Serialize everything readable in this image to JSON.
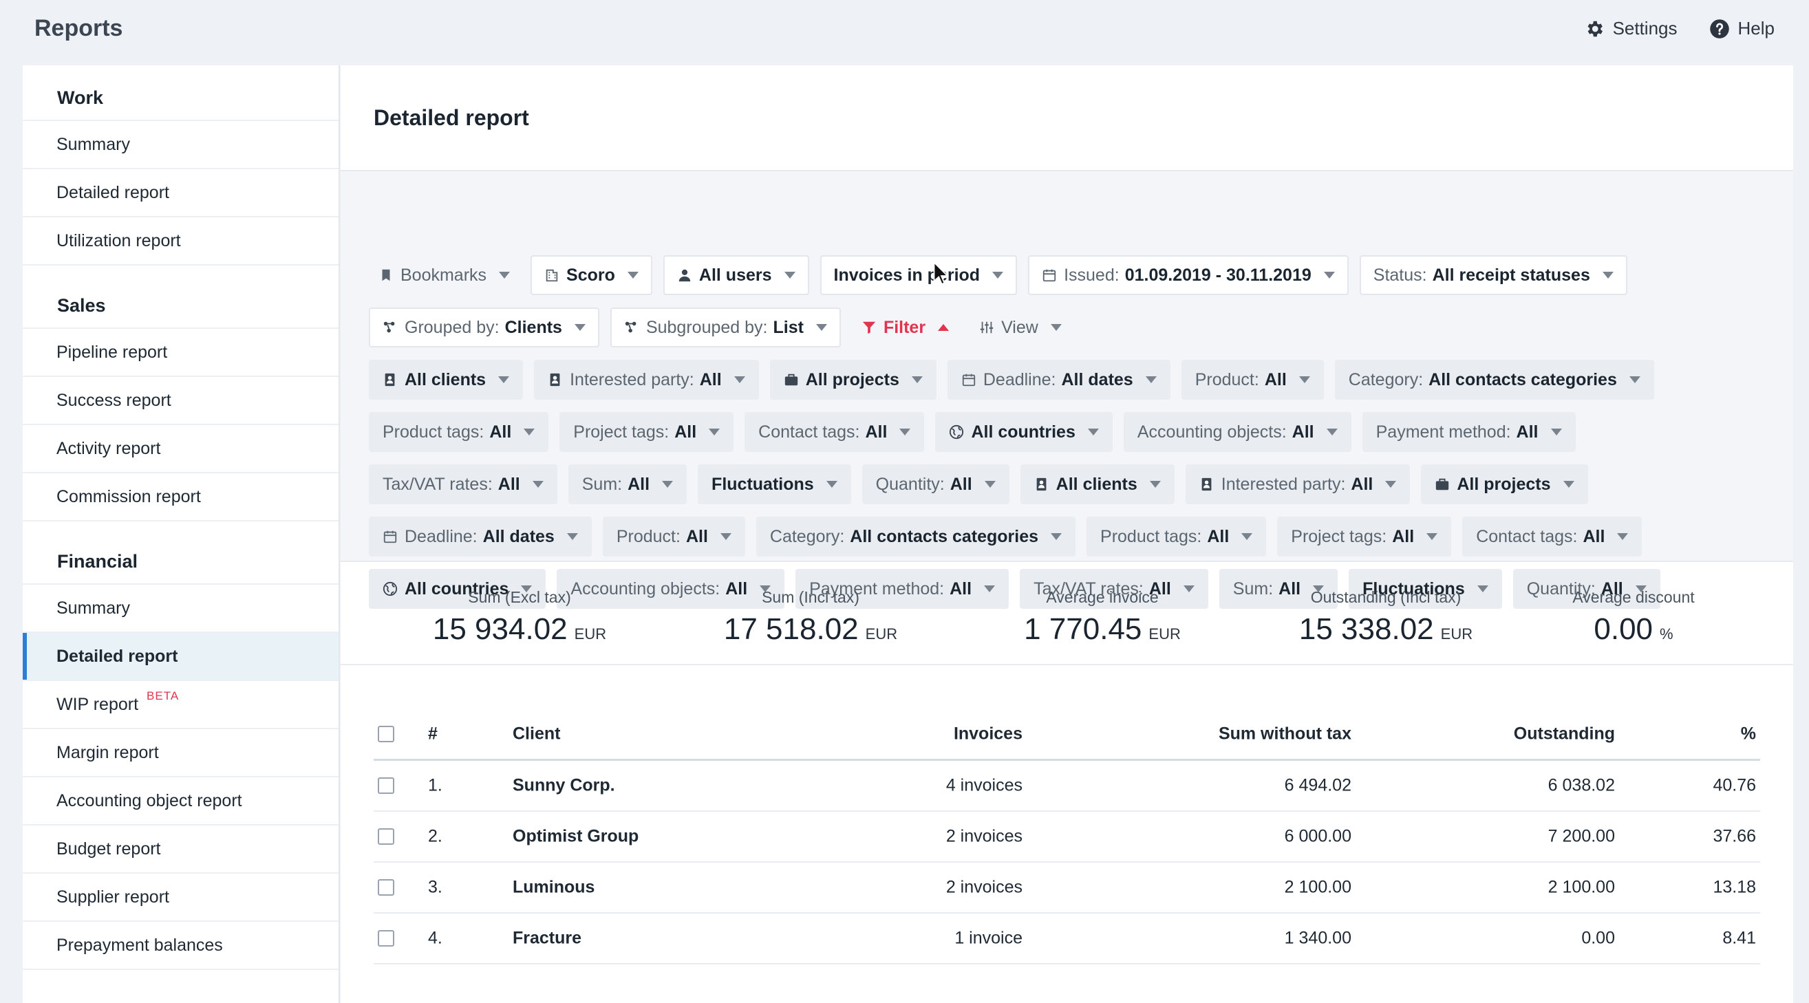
{
  "app": {
    "title": "Reports"
  },
  "top_actions": [
    {
      "label": "Settings",
      "icon": "gear-icon"
    },
    {
      "label": "Help",
      "icon": "help-icon"
    }
  ],
  "sidebar": {
    "sections": [
      {
        "title": "Work",
        "items": [
          {
            "label": "Summary"
          },
          {
            "label": "Detailed report"
          },
          {
            "label": "Utilization report"
          }
        ]
      },
      {
        "title": "Sales",
        "items": [
          {
            "label": "Pipeline report"
          },
          {
            "label": "Success report"
          },
          {
            "label": "Activity report"
          },
          {
            "label": "Commission report"
          }
        ]
      },
      {
        "title": "Financial",
        "items": [
          {
            "label": "Summary"
          },
          {
            "label": "Detailed report",
            "active": true
          },
          {
            "label": "WIP report",
            "badge": "BETA"
          },
          {
            "label": "Margin report"
          },
          {
            "label": "Accounting object report"
          },
          {
            "label": "Budget report"
          },
          {
            "label": "Supplier report"
          },
          {
            "label": "Prepayment balances"
          }
        ]
      }
    ]
  },
  "page": {
    "title": "Detailed report"
  },
  "filters": {
    "row1": [
      {
        "label": "Bookmarks",
        "icon": "bookmark-icon",
        "style": "plain"
      },
      {
        "label": "Scoro",
        "icon": "building-icon",
        "strong": true
      },
      {
        "label": "All users",
        "icon": "user-icon",
        "strong": true
      },
      {
        "label": "Invoices in period",
        "strong": true
      },
      {
        "prefix": "Issued:",
        "value": "01.09.2019 - 30.11.2019",
        "icon": "calendar-icon"
      },
      {
        "prefix": "Status:",
        "value": "All receipt statuses"
      }
    ],
    "row2": [
      {
        "prefix": "Grouped by:",
        "value": "Clients",
        "icon": "group-icon"
      },
      {
        "prefix": "Subgrouped by:",
        "value": "List",
        "icon": "group-icon"
      },
      {
        "label": "Filter",
        "icon": "funnel-icon",
        "style": "filter"
      },
      {
        "label": "View",
        "icon": "sliders-icon",
        "style": "plain"
      }
    ],
    "row3": [
      {
        "label": "All clients",
        "icon": "contact-icon",
        "strong": true
      },
      {
        "prefix": "Interested party:",
        "value": "All",
        "icon": "contact-icon"
      },
      {
        "label": "All projects",
        "icon": "briefcase-icon",
        "strong": true
      },
      {
        "prefix": "Deadline:",
        "value": "All dates",
        "icon": "calendar-icon"
      },
      {
        "prefix": "Product:",
        "value": "All"
      },
      {
        "prefix": "Category:",
        "value": "All contacts categories"
      }
    ],
    "row4": [
      {
        "prefix": "Product tags:",
        "value": "All"
      },
      {
        "prefix": "Project tags:",
        "value": "All"
      },
      {
        "prefix": "Contact tags:",
        "value": "All"
      },
      {
        "label": "All countries",
        "icon": "globe-icon",
        "strong": true
      },
      {
        "prefix": "Accounting objects:",
        "value": "All"
      },
      {
        "prefix": "Payment method:",
        "value": "All"
      }
    ],
    "row5": [
      {
        "prefix": "Tax/VAT rates:",
        "value": "All"
      },
      {
        "prefix": "Sum:",
        "value": "All"
      },
      {
        "label": "Fluctuations",
        "strong": true
      },
      {
        "prefix": "Quantity:",
        "value": "All"
      },
      {
        "label": "All clients",
        "icon": "contact-icon",
        "strong": true
      },
      {
        "prefix": "Interested party:",
        "value": "All",
        "icon": "contact-icon"
      },
      {
        "label": "All projects",
        "icon": "briefcase-icon",
        "strong": true
      }
    ],
    "row6": [
      {
        "prefix": "Deadline:",
        "value": "All dates",
        "icon": "calendar-icon"
      },
      {
        "prefix": "Product:",
        "value": "All"
      },
      {
        "prefix": "Category:",
        "value": "All contacts categories"
      },
      {
        "prefix": "Product tags:",
        "value": "All"
      },
      {
        "prefix": "Project tags:",
        "value": "All"
      },
      {
        "prefix": "Contact tags:",
        "value": "All"
      }
    ],
    "row7": [
      {
        "label": "All countries",
        "icon": "globe-icon",
        "strong": true
      },
      {
        "prefix": "Accounting objects:",
        "value": "All"
      },
      {
        "prefix": "Payment method:",
        "value": "All"
      },
      {
        "prefix": "Tax/VAT rates:",
        "value": "All"
      },
      {
        "prefix": "Sum:",
        "value": "All"
      },
      {
        "label": "Fluctuations",
        "strong": true
      },
      {
        "prefix": "Quantity:",
        "value": "All"
      }
    ]
  },
  "summary": [
    {
      "label": "Sum (Excl tax)",
      "value": "15 934.02",
      "unit": "EUR"
    },
    {
      "label": "Sum (Incl tax)",
      "value": "17 518.02",
      "unit": "EUR"
    },
    {
      "label": "Average invoice",
      "value": "1 770.45",
      "unit": "EUR"
    },
    {
      "label": "Outstanding (Incl tax)",
      "value": "15 338.02",
      "unit": "EUR"
    },
    {
      "label": "Average discount",
      "value": "0.00",
      "unit": "%"
    }
  ],
  "table": {
    "headers": {
      "num": "#",
      "client": "Client",
      "invoices": "Invoices",
      "sum": "Sum without tax",
      "outstanding": "Outstanding",
      "pct": "%"
    },
    "rows": [
      {
        "num": "1.",
        "client": "Sunny Corp.",
        "invoices": "4 invoices",
        "sum": "6 494.02",
        "outstanding": "6 038.02",
        "pct": "40.76"
      },
      {
        "num": "2.",
        "client": "Optimist Group",
        "invoices": "2 invoices",
        "sum": "6 000.00",
        "outstanding": "7 200.00",
        "pct": "37.66"
      },
      {
        "num": "3.",
        "client": "Luminous",
        "invoices": "2 invoices",
        "sum": "2 100.00",
        "outstanding": "2 100.00",
        "pct": "13.18"
      },
      {
        "num": "4.",
        "client": "Fracture",
        "invoices": "1 invoice",
        "sum": "1 340.00",
        "outstanding": "0.00",
        "pct": "8.41"
      }
    ]
  },
  "colors": {
    "accent": "#2b7fd4",
    "filter_red": "#e0344f",
    "beta_red": "#e0344f"
  }
}
